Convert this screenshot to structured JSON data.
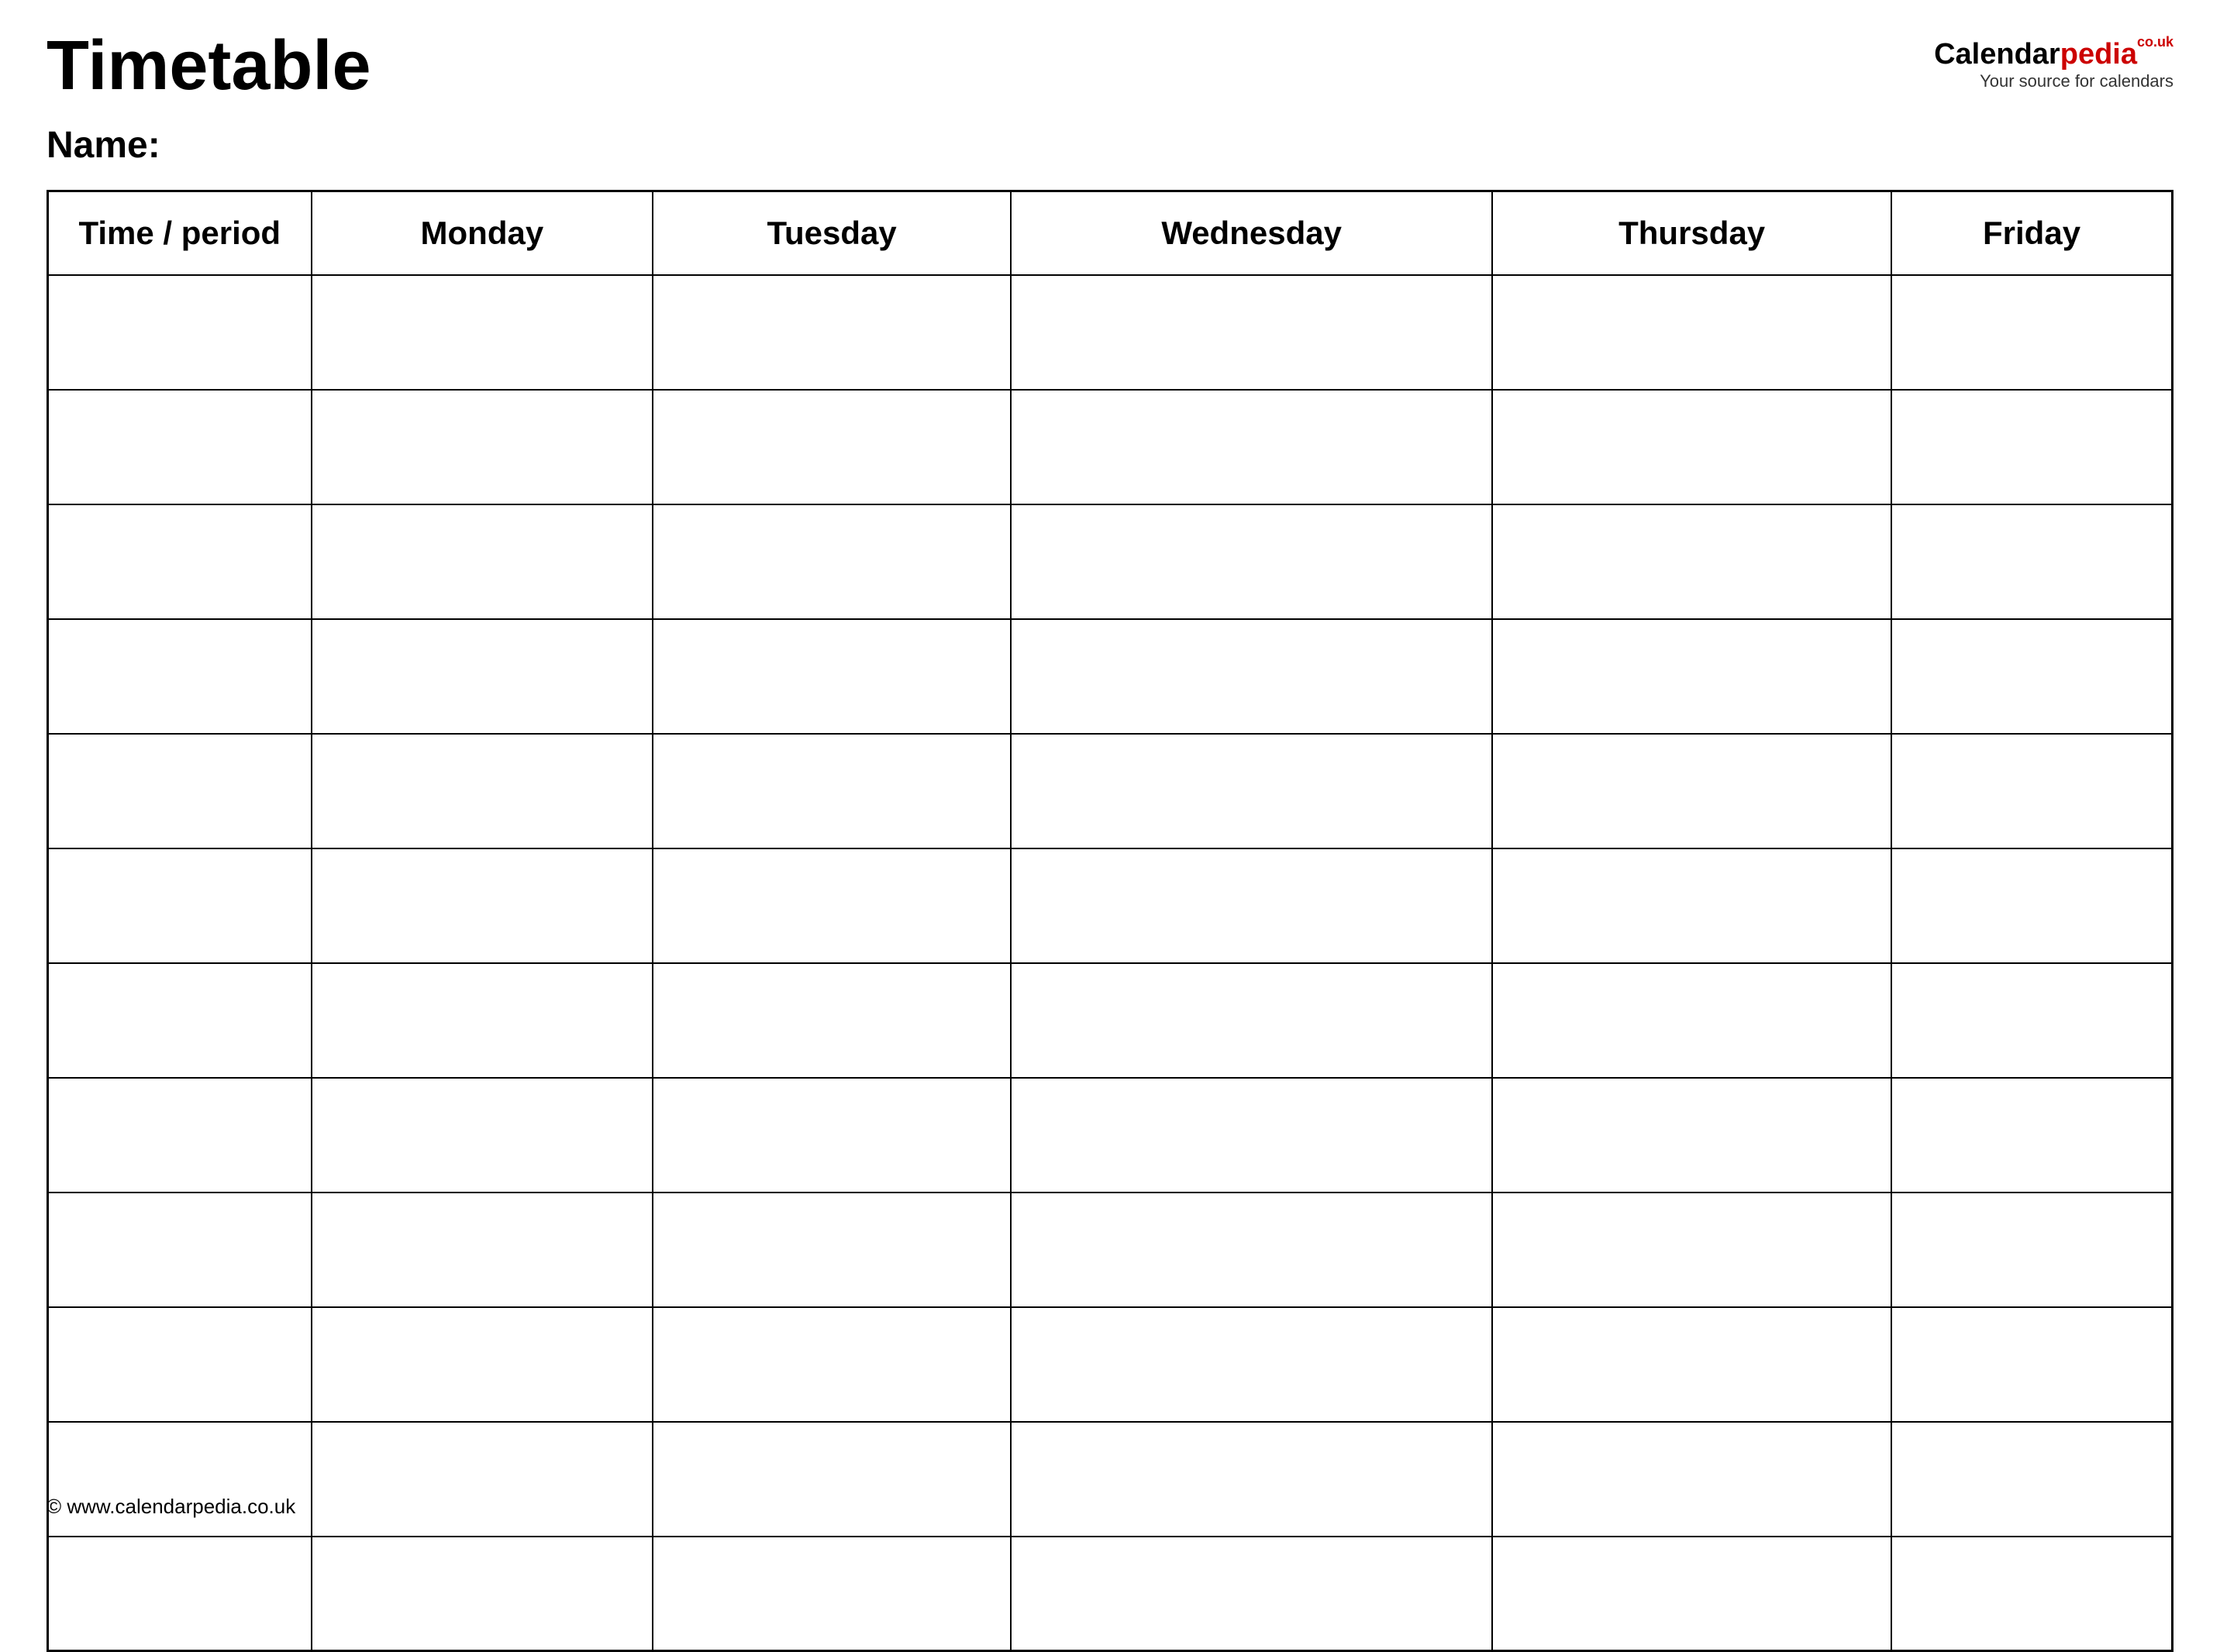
{
  "header": {
    "title": "Timetable",
    "logo": {
      "calendar": "Calendar",
      "pedia": "pedia",
      "couk": "co.uk",
      "tagline": "Your source for calendars"
    }
  },
  "name_label": "Name:",
  "table": {
    "columns": [
      "Time / period",
      "Monday",
      "Tuesday",
      "Wednesday",
      "Thursday",
      "Friday"
    ],
    "row_count": 12
  },
  "footer": {
    "url": "© www.calendarpedia.co.uk"
  }
}
